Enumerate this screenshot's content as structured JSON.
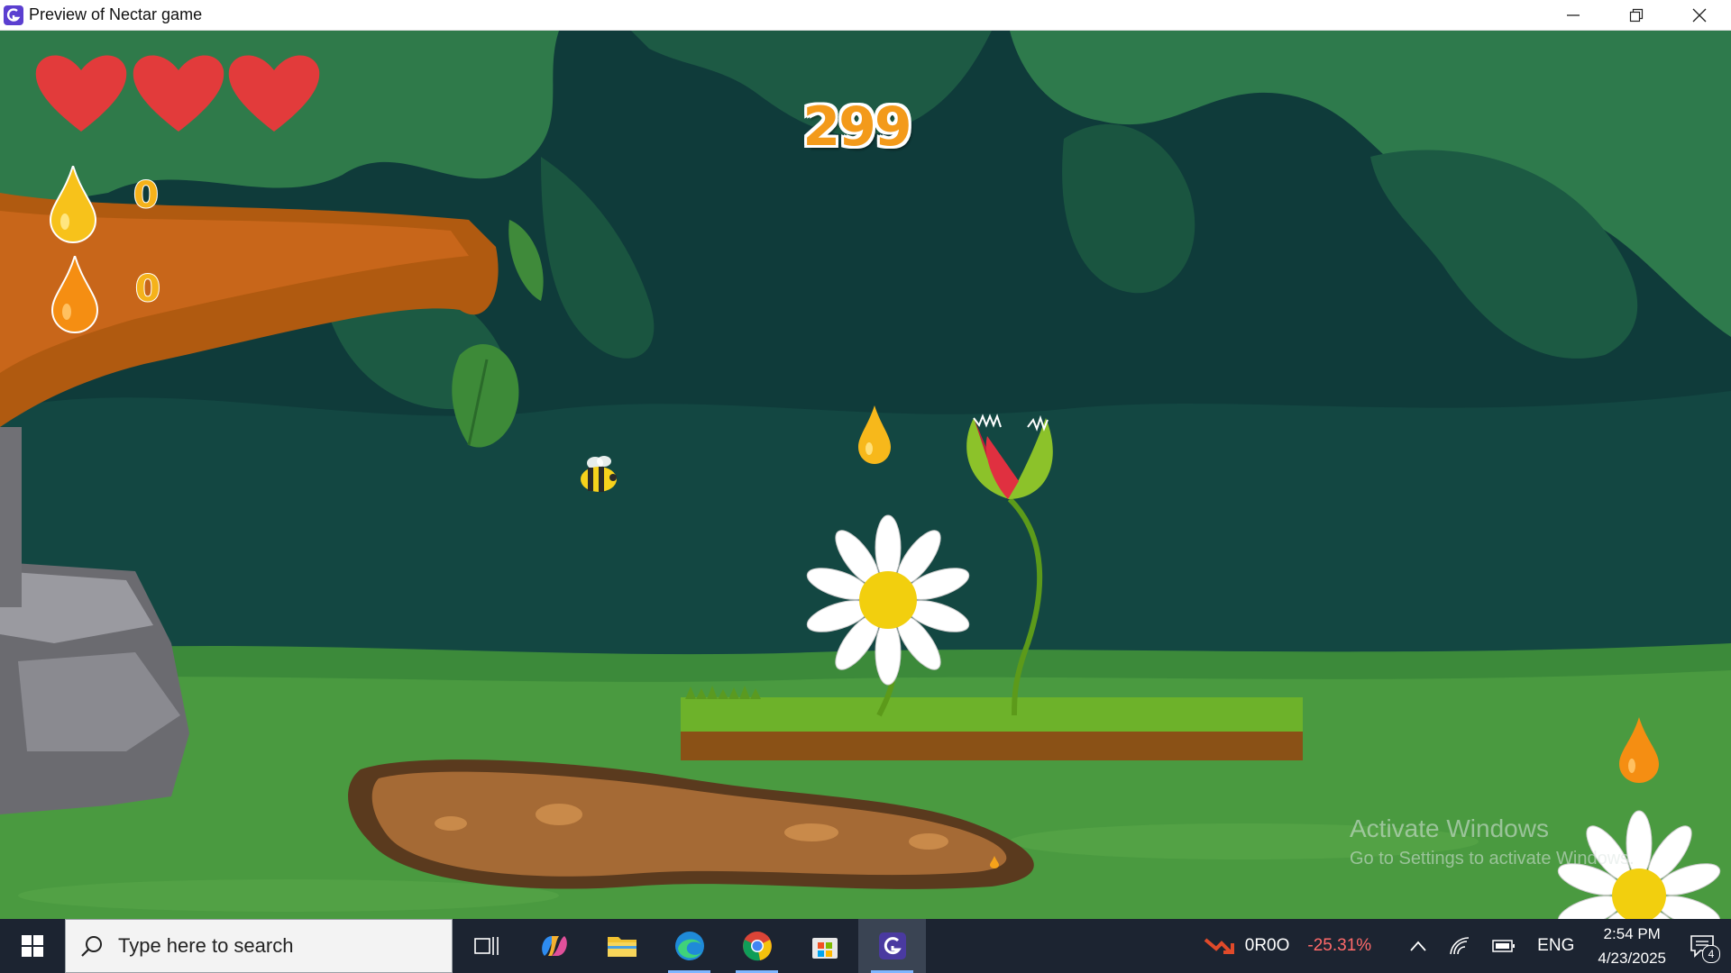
{
  "window": {
    "title": "Preview of Nectar game",
    "controls": [
      "minimize",
      "restore",
      "close"
    ]
  },
  "game": {
    "score": "299",
    "lives": 3,
    "nectar_counters": [
      {
        "icon": "yellow-drop-icon",
        "value": "0"
      },
      {
        "icon": "orange-drop-icon",
        "value": "0"
      }
    ],
    "watermark": {
      "line1": "Activate Windows",
      "line2": "Go to Settings to activate Windows."
    },
    "colors": {
      "heart": "#e23b3b",
      "score": "#f39a1a",
      "drop_yellow": "#f7c21b",
      "drop_orange": "#f58e12",
      "sky": "#0f3b3a",
      "grass": "#6aa324"
    }
  },
  "taskbar": {
    "search_placeholder": "Type here to search",
    "pinned": [
      "task-view",
      "copilot",
      "file-explorer",
      "edge",
      "chrome",
      "microsoft-store",
      "game-maker"
    ],
    "stock": {
      "ticker": "0R0O",
      "change": "-25.31%"
    },
    "language": "ENG",
    "time": "2:54 PM",
    "date": "4/23/2025",
    "notifications": "4"
  }
}
